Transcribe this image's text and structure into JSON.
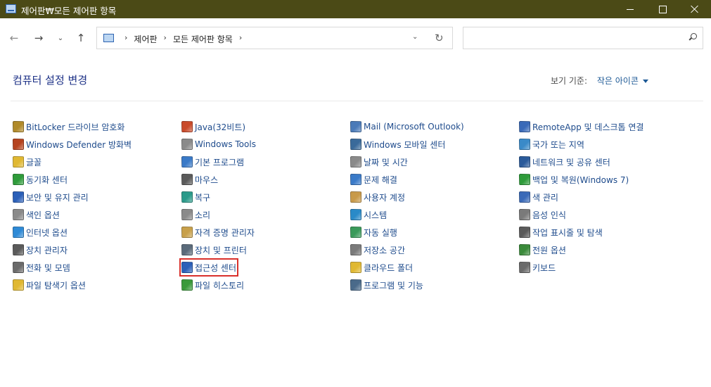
{
  "window": {
    "title": "제어판₩모든 제어판 항목"
  },
  "nav": {
    "back": "←",
    "forward": "→",
    "recent": "⌄",
    "up": "↑",
    "breadcrumbs": [
      "제어판",
      "모든 제어판 항목"
    ],
    "crumb_sep": "›",
    "refresh": "↻",
    "dropdown": "⌄",
    "search_placeholder": ""
  },
  "header": {
    "title": "컴퓨터 설정 변경",
    "view_by_label": "보기 기준:",
    "view_by_value": "작은 아이콘"
  },
  "columns": [
    [
      {
        "label": "BitLocker 드라이브 암호화",
        "icon": "bitlocker-icon",
        "color": "#b08a2a"
      },
      {
        "label": "Windows Defender 방화벽",
        "icon": "firewall-icon",
        "color": "#b5431f"
      },
      {
        "label": "글꼴",
        "icon": "fonts-icon",
        "color": "#e0b832"
      },
      {
        "label": "동기화 센터",
        "icon": "sync-icon",
        "color": "#2e9b3a"
      },
      {
        "label": "보안 및 유지 관리",
        "icon": "flag-icon",
        "color": "#2a5fb8"
      },
      {
        "label": "색인 옵션",
        "icon": "indexing-icon",
        "color": "#8a8a8a"
      },
      {
        "label": "인터넷 옵션",
        "icon": "internet-icon",
        "color": "#2e8ad6"
      },
      {
        "label": "장치 관리자",
        "icon": "device-manager-icon",
        "color": "#5a5a5a"
      },
      {
        "label": "전화 및 모뎀",
        "icon": "phone-modem-icon",
        "color": "#6a6a6a"
      },
      {
        "label": "파일 탐색기 옵션",
        "icon": "folder-options-icon",
        "color": "#e0b832"
      }
    ],
    [
      {
        "label": "Java(32비트)",
        "icon": "java-icon",
        "color": "#c94a2a"
      },
      {
        "label": "Windows Tools",
        "icon": "tools-icon",
        "color": "#8a8a8a"
      },
      {
        "label": "기본 프로그램",
        "icon": "default-programs-icon",
        "color": "#3a7ac8"
      },
      {
        "label": "마우스",
        "icon": "mouse-icon",
        "color": "#5a5a5a"
      },
      {
        "label": "복구",
        "icon": "recovery-icon",
        "color": "#2a9a8a"
      },
      {
        "label": "소리",
        "icon": "sound-icon",
        "color": "#8a8a8a"
      },
      {
        "label": "자격 증명 관리자",
        "icon": "credential-icon",
        "color": "#c8a04a"
      },
      {
        "label": "장치 및 프린터",
        "icon": "printer-icon",
        "color": "#5a6a7a"
      },
      {
        "label": "접근성 센터",
        "icon": "accessibility-icon",
        "color": "#2a5fb8",
        "selected": true
      },
      {
        "label": "파일 히스토리",
        "icon": "file-history-icon",
        "color": "#3a9a3a"
      }
    ],
    [
      {
        "label": "Mail (Microsoft Outlook)",
        "icon": "mail-icon",
        "color": "#4a7ab8"
      },
      {
        "label": "Windows 모바일 센터",
        "icon": "mobility-icon",
        "color": "#3a6a9a"
      },
      {
        "label": "날짜 및 시간",
        "icon": "clock-icon",
        "color": "#8a8a8a"
      },
      {
        "label": "문제 해결",
        "icon": "troubleshoot-icon",
        "color": "#3a7ac8"
      },
      {
        "label": "사용자 계정",
        "icon": "users-icon",
        "color": "#c89a4a"
      },
      {
        "label": "시스템",
        "icon": "system-icon",
        "color": "#2a8ac8"
      },
      {
        "label": "자동 실행",
        "icon": "autoplay-icon",
        "color": "#3a9a5a"
      },
      {
        "label": "저장소 공간",
        "icon": "storage-icon",
        "color": "#7a7a7a"
      },
      {
        "label": "클라우드 폴더",
        "icon": "cloud-folder-icon",
        "color": "#e0b832"
      },
      {
        "label": "프로그램 및 기능",
        "icon": "programs-icon",
        "color": "#4a6a8a"
      }
    ],
    [
      {
        "label": "RemoteApp 및 데스크톱 연결",
        "icon": "remoteapp-icon",
        "color": "#3a6ab8"
      },
      {
        "label": "국가 또는 지역",
        "icon": "region-icon",
        "color": "#3a8ac8"
      },
      {
        "label": "네트워크 및 공유 센터",
        "icon": "network-icon",
        "color": "#2a5a9a"
      },
      {
        "label": "백업 및 복원(Windows 7)",
        "icon": "backup-icon",
        "color": "#2e9b3a"
      },
      {
        "label": "색 관리",
        "icon": "color-management-icon",
        "color": "#3a6ab8"
      },
      {
        "label": "음성 인식",
        "icon": "microphone-icon",
        "color": "#7a7a7a"
      },
      {
        "label": "작업 표시줄 및 탐색",
        "icon": "taskbar-icon",
        "color": "#5a5a5a"
      },
      {
        "label": "전원 옵션",
        "icon": "power-icon",
        "color": "#3a8a3a"
      },
      {
        "label": "키보드",
        "icon": "keyboard-icon",
        "color": "#6a6a6a"
      }
    ]
  ]
}
